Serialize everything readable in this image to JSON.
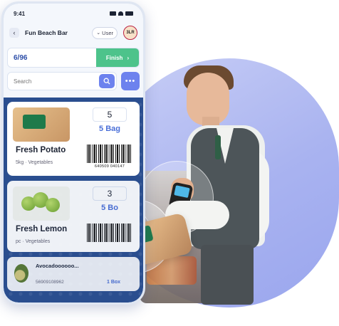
{
  "status_bar": {
    "time": "9:41"
  },
  "header": {
    "store_name": "Fun Beach Bar",
    "user_label": "User",
    "avatar_text": "3LR"
  },
  "progress": {
    "count_text": "6/96",
    "finish_label": "Finish"
  },
  "search": {
    "placeholder": "Search",
    "more_label": "•••"
  },
  "products": [
    {
      "name": "Fresh Potato",
      "meta": "5kg · Vegetables",
      "qty": "5",
      "unit": "5 Bag",
      "barcode": "640509 040147"
    },
    {
      "name": "Fresh Lemon",
      "meta": "pc · Vegetables",
      "qty": "3",
      "unit": "5 Bo"
    },
    {
      "name": "Avocadoooooo...",
      "code": "56909108962",
      "unit": "1 Box"
    }
  ],
  "colors": {
    "accent": "#6d82ee",
    "finish": "#4dc38b",
    "list_bg": "#2a4e8f",
    "blob": "#a9b3f0"
  }
}
